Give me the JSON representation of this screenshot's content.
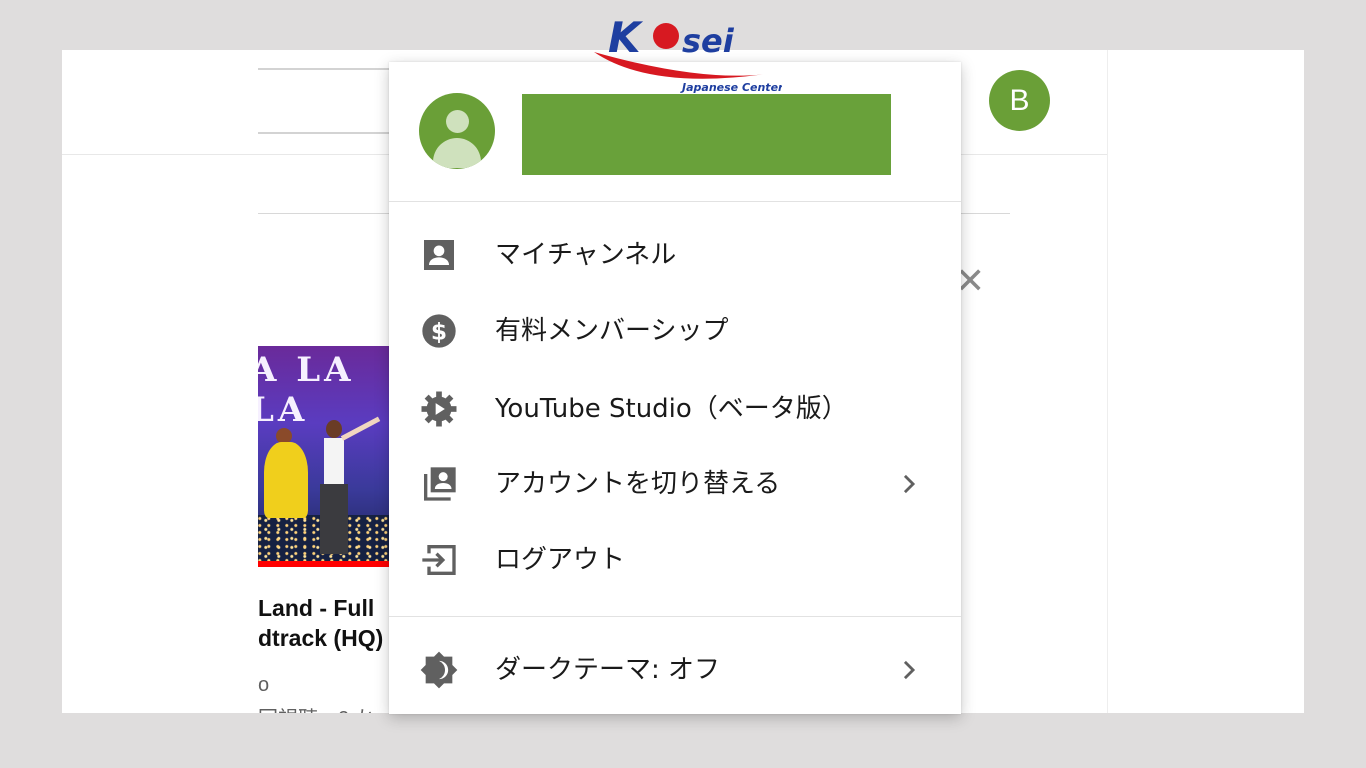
{
  "header": {
    "avatar_initial": "B"
  },
  "background": {
    "close_symbol": "✕",
    "thumbnail_text": "A LA LA",
    "video_title": "Land - Full\ndtrack (HQ)",
    "video_meta_1": "o",
    "video_meta_2": "回視聴・2 か"
  },
  "account_menu": {
    "items": [
      {
        "label": "マイチャンネル",
        "icon": "person-icon"
      },
      {
        "label": "有料メンバーシップ",
        "icon": "dollar-icon"
      },
      {
        "label": "YouTube Studio（ベータ版）",
        "icon": "gear-play-icon"
      },
      {
        "label": "アカウントを切り替える",
        "icon": "switch-account-icon",
        "has_submenu": true
      },
      {
        "label": "ログアウト",
        "icon": "logout-icon"
      }
    ],
    "theme_item": {
      "label": "ダークテーマ: オフ",
      "icon": "dark-theme-icon",
      "has_submenu": true
    }
  },
  "watermark": {
    "brand": "Kosei",
    "tagline": "Japanese Center"
  },
  "colors": {
    "avatar_green": "#6a9f37",
    "icon_gray": "#606060",
    "brand_blue": "#1e3ea0",
    "brand_red": "#d71921"
  }
}
